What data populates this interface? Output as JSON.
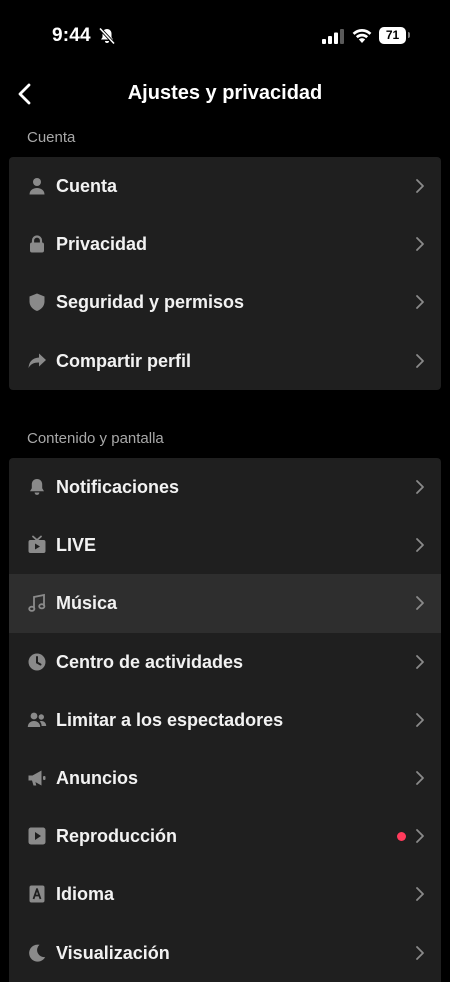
{
  "status_bar": {
    "time": "9:44",
    "battery": "71"
  },
  "header": {
    "title": "Ajustes y privacidad"
  },
  "sections": [
    {
      "label": "Cuenta",
      "items": [
        {
          "label": "Cuenta",
          "icon": "person-icon"
        },
        {
          "label": "Privacidad",
          "icon": "lock-icon"
        },
        {
          "label": "Seguridad y permisos",
          "icon": "shield-icon"
        },
        {
          "label": "Compartir perfil",
          "icon": "share-icon"
        }
      ]
    },
    {
      "label": "Contenido y pantalla",
      "items": [
        {
          "label": "Notificaciones",
          "icon": "bell-icon"
        },
        {
          "label": "LIVE",
          "icon": "tv-icon"
        },
        {
          "label": "Música",
          "icon": "music-note-icon"
        },
        {
          "label": "Centro de actividades",
          "icon": "clock-icon"
        },
        {
          "label": "Limitar a los espectadores",
          "icon": "people-icon"
        },
        {
          "label": "Anuncios",
          "icon": "megaphone-icon"
        },
        {
          "label": "Reproducción",
          "icon": "play-icon"
        },
        {
          "label": "Idioma",
          "icon": "language-icon"
        },
        {
          "label": "Visualización",
          "icon": "moon-icon"
        }
      ]
    }
  ],
  "colors": {
    "background": "#000000",
    "card": "#1f1f1f",
    "highlight": "#2e2e2e",
    "icon": "#8a8a8a",
    "dot": "#ff3b5c"
  }
}
